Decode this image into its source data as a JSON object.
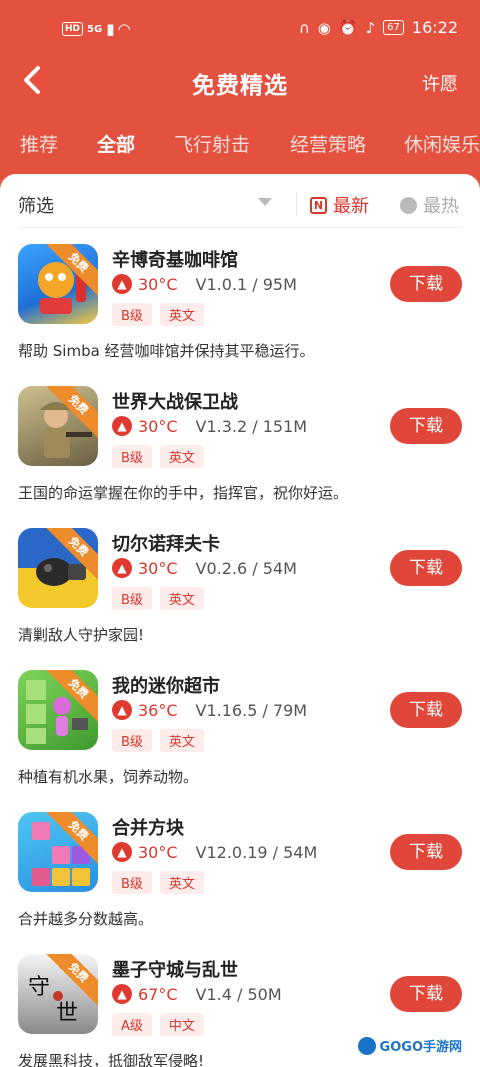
{
  "status_bar": {
    "time": "16:22",
    "battery": "67",
    "network_left": "HD",
    "network_mid": "5G"
  },
  "header": {
    "title": "免费精选",
    "wish_label": "许愿"
  },
  "tabs": [
    {
      "label": "推荐"
    },
    {
      "label": "全部"
    },
    {
      "label": "飞行射击"
    },
    {
      "label": "经营策略"
    },
    {
      "label": "休闲娱乐"
    }
  ],
  "filter": {
    "label": "筛选",
    "newest": "最新",
    "hottest": "最热"
  },
  "badge_text": "免费",
  "download_label": "下载",
  "items": [
    {
      "name": "辛博奇基咖啡馆",
      "temp": "30°C",
      "version_size": "V1.0.1 / 95M",
      "grade": "B级",
      "lang": "英文",
      "desc": "帮助 Simba 经营咖啡馆并保持其平稳运行。"
    },
    {
      "name": "世界大战保卫战",
      "temp": "30°C",
      "version_size": "V1.3.2 / 151M",
      "grade": "B级",
      "lang": "英文",
      "desc": "王国的命运掌握在你的手中，指挥官，祝你好运。"
    },
    {
      "name": "切尔诺拜夫卡",
      "temp": "30°C",
      "version_size": "V0.2.6 / 54M",
      "grade": "B级",
      "lang": "英文",
      "desc": "清剿敌人守护家园!"
    },
    {
      "name": "我的迷你超市",
      "temp": "36°C",
      "version_size": "V1.16.5 / 79M",
      "grade": "B级",
      "lang": "英文",
      "desc": "种植有机水果，饲养动物。"
    },
    {
      "name": "合并方块",
      "temp": "30°C",
      "version_size": "V12.0.19 / 54M",
      "grade": "B级",
      "lang": "英文",
      "desc": "合并越多分数越高。"
    },
    {
      "name": "墨子守城与乱世",
      "temp": "67°C",
      "version_size": "V1.4 / 50M",
      "grade": "A级",
      "lang": "中文",
      "desc": "发展黑科技，抵御敌军侵略!"
    }
  ],
  "watermark": "GOGO手游网",
  "colors": {
    "brand": "#e4523f",
    "accent": "#d9372c",
    "download": "#e0463a"
  }
}
